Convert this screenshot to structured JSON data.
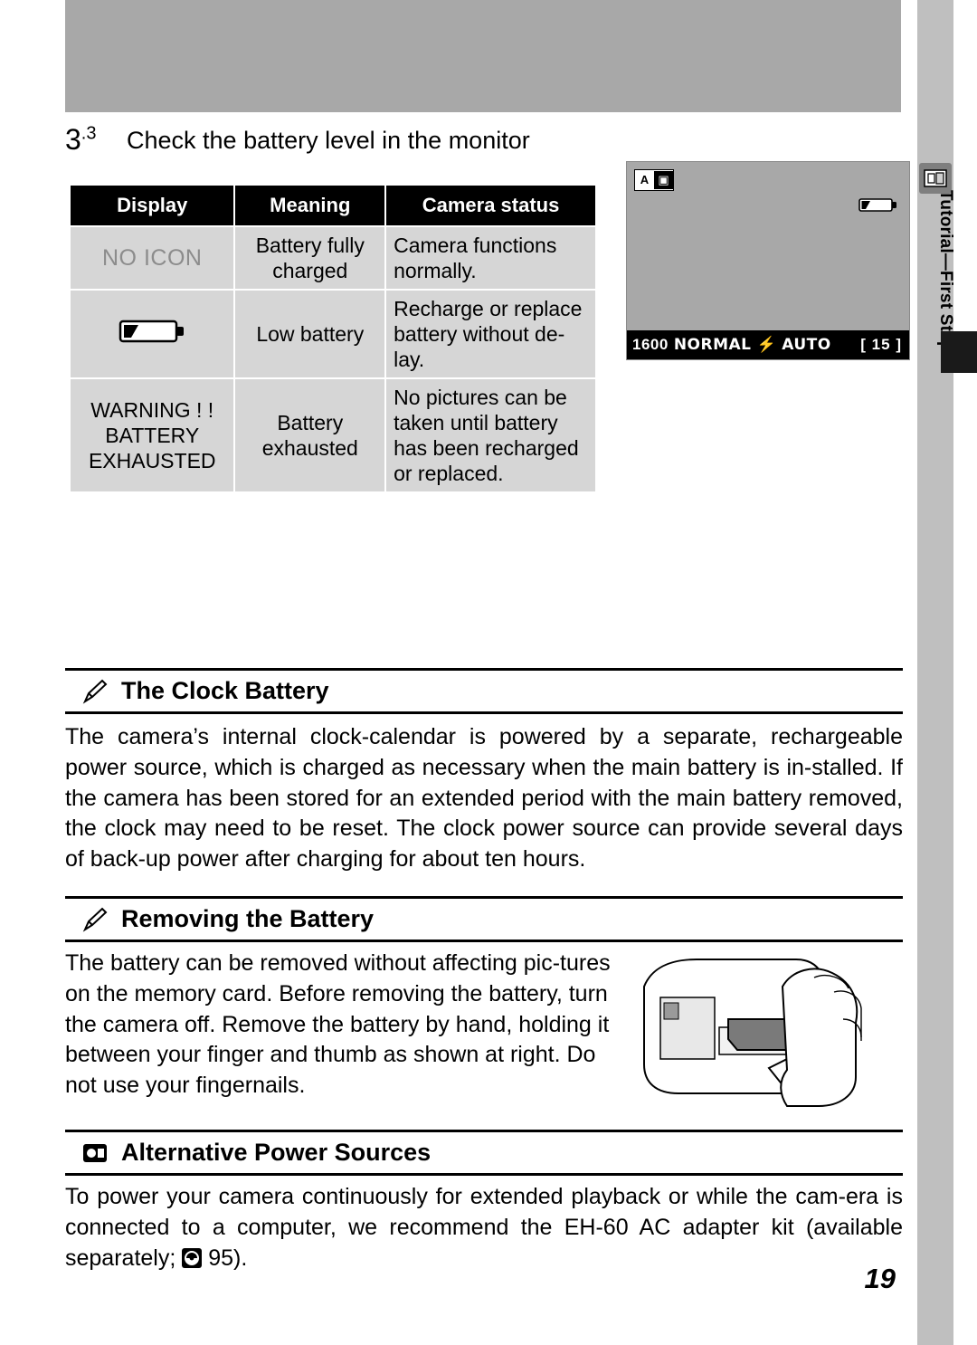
{
  "page": {
    "number": "19",
    "section_number": "3.3",
    "section_title": "Check the battery level in the monitor",
    "side_tab_label": "Tutorial—First Steps"
  },
  "table": {
    "headers": [
      "Display",
      "Meaning",
      "Camera status"
    ],
    "rows": [
      {
        "display": "NO ICON",
        "display_kind": "text",
        "meaning": "Battery fully charged",
        "status": "Camera functions normally."
      },
      {
        "display": "",
        "display_kind": "battery-icon",
        "meaning": "Low battery",
        "status": "Recharge or replace battery without de-lay."
      },
      {
        "display": "WARNING ! ! BATTERY EXHAUSTED",
        "display_kind": "text",
        "meaning": "Battery exhausted",
        "status": "No pictures can be taken until battery has been recharged or replaced."
      }
    ]
  },
  "monitor": {
    "mode_badge_left": "A",
    "mode_badge_right": "camera-icon",
    "image_size": "1600",
    "quality": "NORMAL",
    "flash": "flash-icon",
    "exposure_mode": "AUTO",
    "frames_remaining": "15",
    "bracket_left": "[",
    "bracket_right": "]"
  },
  "notes": [
    {
      "icon": "pencil-icon",
      "title": "The Clock Battery",
      "body": "The camera’s internal clock-calendar is powered by a separate, rechargeable power source, which is charged as necessary when the main battery is in-stalled.  If the camera has been stored for an extended period with the main battery removed, the clock may need to be reset.  The clock power source can provide several days of back-up power after charging for about ten hours."
    },
    {
      "icon": "pencil-icon",
      "title": "Removing the Battery",
      "body": "The battery can be removed without affecting pic-tures on the memory card.  Before removing the battery, turn the camera off.  Remove the battery by hand, holding it between your finger and thumb as shown at right.  Do not use your fingernails."
    },
    {
      "icon": "power-icon",
      "title": "Alternative Power Sources",
      "body_before": "To power your camera continuously for extended playback or while the cam-era is connected to a computer, we recommend the EH-60 AC adapter kit (available separately; ",
      "body_after": " 95)."
    }
  ]
}
